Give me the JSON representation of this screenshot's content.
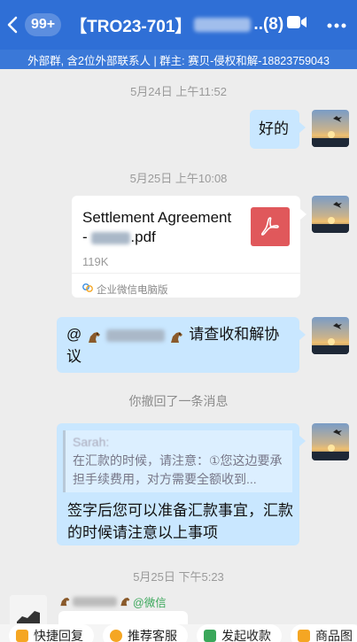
{
  "header": {
    "unread_count": "99+",
    "title_prefix": "【TRO23-701】",
    "title_suffix": "..(8)",
    "subtitle": "外部群, 含2位外部联系人 | 群主: 赛贝-侵权和解-18823759043"
  },
  "messages": {
    "t1": "5月24日 上午11:52",
    "m1_text": "好的",
    "t2": "5月25日 上午10:08",
    "file_title": "Settlement Agreement",
    "file_dash": "-",
    "file_ext": ".pdf",
    "file_size": "119K",
    "file_source": "企业微信电脑版",
    "m3_at": "@",
    "m3_text": "请查收和解协议",
    "recall": "你撤回了一条消息",
    "quote_name": "Sarah:",
    "quote_text": "在汇款的时候，请注意：①您这边要承担手续费用，对方需要全额收到...",
    "m4_text": "签字后您可以准备汇款事宜，汇款的时候请注意以上事项",
    "t3": "5月25日 下午5:23",
    "wechat_tag": "@微信"
  },
  "quickbar": {
    "items": [
      "快捷回复",
      "推荐客服",
      "发起收款",
      "商品图"
    ]
  },
  "colors": {
    "header_bg": "#2f6fd6",
    "bubble_self": "#c9e7ff",
    "pdf_red": "#e0585b"
  }
}
